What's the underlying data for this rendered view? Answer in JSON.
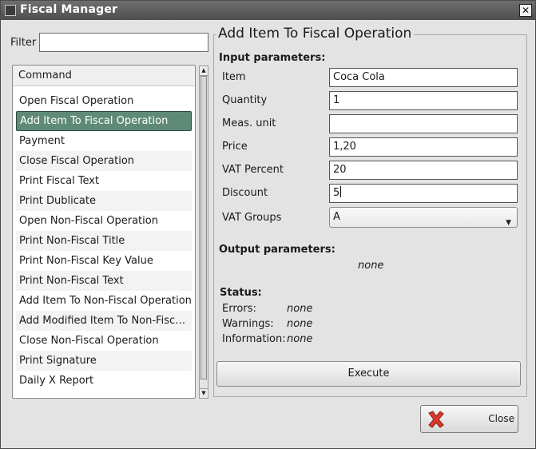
{
  "window": {
    "title": "Fiscal Manager"
  },
  "filter": {
    "label": "Filter",
    "value": ""
  },
  "commands": {
    "header": "Command",
    "items": [
      "Open Fiscal Operation",
      "Add Item To Fiscal Operation",
      "Payment",
      "Close Fiscal Operation",
      "Print Fiscal Text",
      "Print Dublicate",
      "Open Non-Fiscal Operation",
      "Print Non-Fiscal Title",
      "Print Non-Fiscal Key Value",
      "Print Non-Fiscal Text",
      "Add Item To Non-Fiscal Operation",
      "Add Modified Item To Non-Fiscal...",
      "Close Non-Fiscal Operation",
      "Print Signature",
      "Daily X Report"
    ],
    "selected_index": 1
  },
  "operation": {
    "title": "Add Item To Fiscal Operation",
    "input_header": "Input parameters:",
    "params": [
      {
        "label": "Item",
        "value": "Coca Cola"
      },
      {
        "label": "Quantity",
        "value": "1"
      },
      {
        "label": "Meas. unit",
        "value": ""
      },
      {
        "label": "Price",
        "value": "1,20"
      },
      {
        "label": "VAT Percent",
        "value": "20"
      },
      {
        "label": "Discount",
        "value": "5"
      }
    ],
    "vat_groups": {
      "label": "VAT Groups",
      "value": "A"
    },
    "output_header": "Output parameters:",
    "output_value": "none",
    "status_header": "Status:",
    "status": [
      {
        "label": "Errors:",
        "value": "none"
      },
      {
        "label": "Warnings:",
        "value": "none"
      },
      {
        "label": "Information:",
        "value": "none"
      }
    ],
    "execute_label": "Execute"
  },
  "footer": {
    "close_label": "Close",
    "close_icon": "red-x-icon"
  },
  "colors": {
    "selection": "#5f8a78",
    "titlebar": "#5c5c5c",
    "close_icon": "#d93a2a"
  }
}
